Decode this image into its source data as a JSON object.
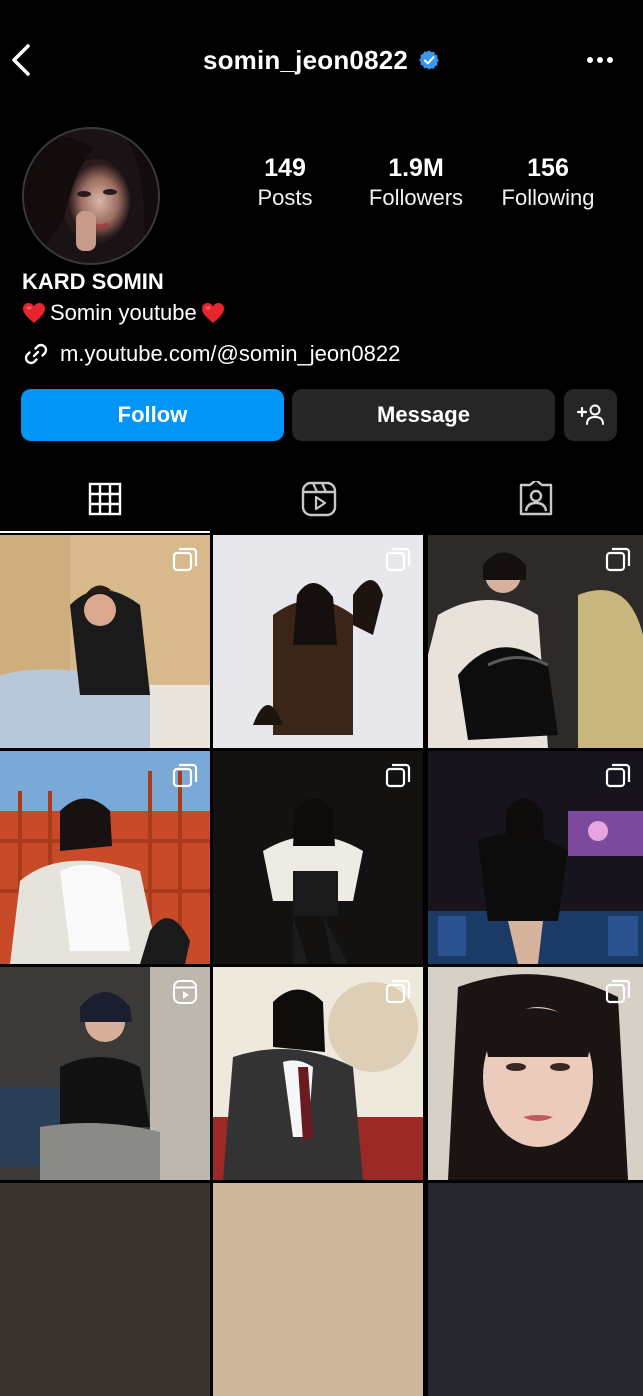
{
  "header": {
    "username": "somin_jeon0822",
    "back_icon": "chevron-left-icon",
    "verified_icon": "verified-badge-icon",
    "more_icon": "more-horizontal-icon"
  },
  "profile": {
    "display_name": "KARD SOMIN",
    "bio_text": "Somin youtube",
    "link": "m.youtube.com/@somin_jeon0822",
    "stats": [
      {
        "value": "149",
        "label": "Posts"
      },
      {
        "value": "1.9M",
        "label": "Followers"
      },
      {
        "value": "156",
        "label": "Following"
      }
    ]
  },
  "actions": {
    "follow_label": "Follow",
    "message_label": "Message",
    "add_user_icon": "add-user-icon"
  },
  "tabs": [
    {
      "name": "posts",
      "icon": "grid-icon",
      "active": true
    },
    {
      "name": "reels",
      "icon": "reels-icon",
      "active": false
    },
    {
      "name": "tagged",
      "icon": "tagged-icon",
      "active": false
    }
  ],
  "posts": [
    {
      "kind": "carousel"
    },
    {
      "kind": "carousel"
    },
    {
      "kind": "carousel"
    },
    {
      "kind": "carousel"
    },
    {
      "kind": "carousel"
    },
    {
      "kind": "carousel"
    },
    {
      "kind": "reel"
    },
    {
      "kind": "carousel"
    },
    {
      "kind": "carousel"
    }
  ],
  "colors": {
    "background": "#000000",
    "accent": "#0095f6",
    "button_secondary": "#262626",
    "verified": "#3897f0"
  }
}
